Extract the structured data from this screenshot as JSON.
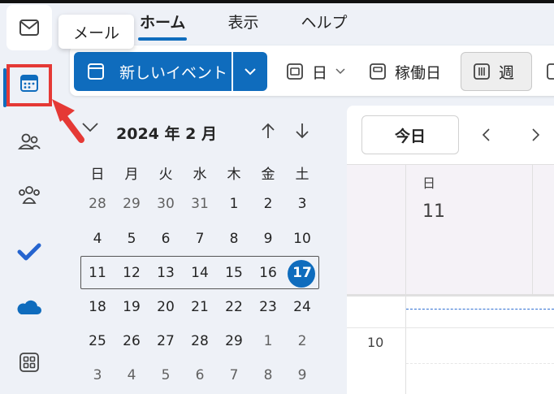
{
  "tooltip": "メール",
  "tabs": [
    {
      "label": "ホーム",
      "active": true
    },
    {
      "label": "表示",
      "active": false
    },
    {
      "label": "ヘルプ",
      "active": false
    }
  ],
  "ribbon": {
    "new_event": "新しいイベント",
    "day": "日",
    "work_week": "稼働日",
    "week": "週"
  },
  "mini_calendar": {
    "title": "2024 年 2 月",
    "weekdays": [
      "日",
      "月",
      "火",
      "水",
      "木",
      "金",
      "土"
    ],
    "weeks": [
      [
        "28",
        "29",
        "30",
        "31",
        "1",
        "2",
        "3"
      ],
      [
        "4",
        "5",
        "6",
        "7",
        "8",
        "9",
        "10"
      ],
      [
        "11",
        "12",
        "13",
        "14",
        "15",
        "16",
        "17"
      ],
      [
        "18",
        "19",
        "20",
        "21",
        "22",
        "23",
        "24"
      ],
      [
        "25",
        "26",
        "27",
        "28",
        "29",
        "1",
        "2"
      ],
      [
        "3",
        "4",
        "5",
        "6",
        "7",
        "8",
        "9"
      ]
    ],
    "today": "17"
  },
  "main": {
    "today_button": "今日",
    "day_name": "日",
    "day_number": "11",
    "hour_label": "10"
  },
  "colors": {
    "accent": "#0f6cbd",
    "highlight": "#e53935"
  },
  "icons": [
    "mail-icon",
    "calendar-icon",
    "people-icon",
    "groups-icon",
    "todo-icon",
    "onedrive-icon",
    "apps-icon"
  ]
}
